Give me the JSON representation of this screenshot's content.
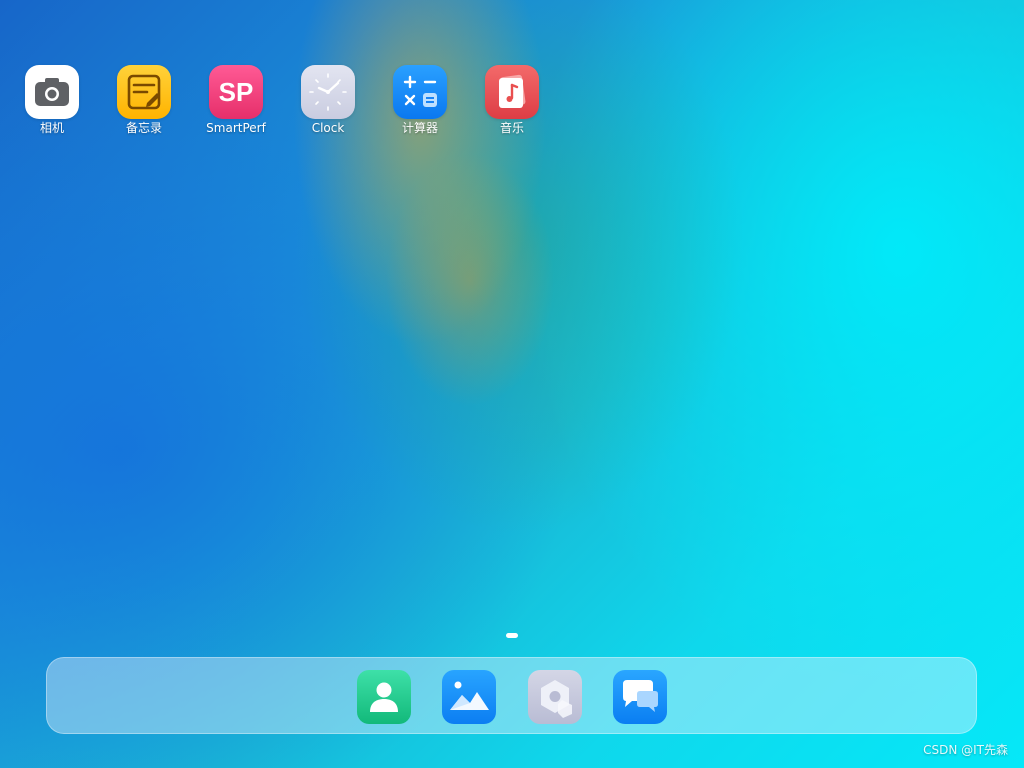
{
  "home": {
    "apps": [
      {
        "label": "相机",
        "icon": "camera-icon"
      },
      {
        "label": "备忘录",
        "icon": "memo-icon"
      },
      {
        "label": "SmartPerf",
        "icon": "smartperf-icon",
        "badge_text": "SP"
      },
      {
        "label": "Clock",
        "icon": "clock-icon"
      },
      {
        "label": "计算器",
        "icon": "calculator-icon"
      },
      {
        "label": "音乐",
        "icon": "music-icon"
      }
    ],
    "page_indicator": {
      "current": 1,
      "total": 1
    }
  },
  "dock": {
    "apps": [
      {
        "icon": "contacts-icon"
      },
      {
        "icon": "gallery-icon"
      },
      {
        "icon": "settings-icon"
      },
      {
        "icon": "messages-icon"
      }
    ]
  },
  "watermark": "CSDN @IT先森",
  "colors": {
    "camera_tile": "#ffffff",
    "memo_tile": "#ffc21a",
    "smartperf_tile": "#f0407a",
    "clock_tile": "#d9dcec",
    "calculator_tile": "#1a8cff",
    "music_tile": "#e94f4f",
    "contacts_tile": "#22c98a",
    "gallery_tile": "#1e90ff",
    "settings_tile": "#c9ccde",
    "messages_tile": "#1b8cff"
  }
}
